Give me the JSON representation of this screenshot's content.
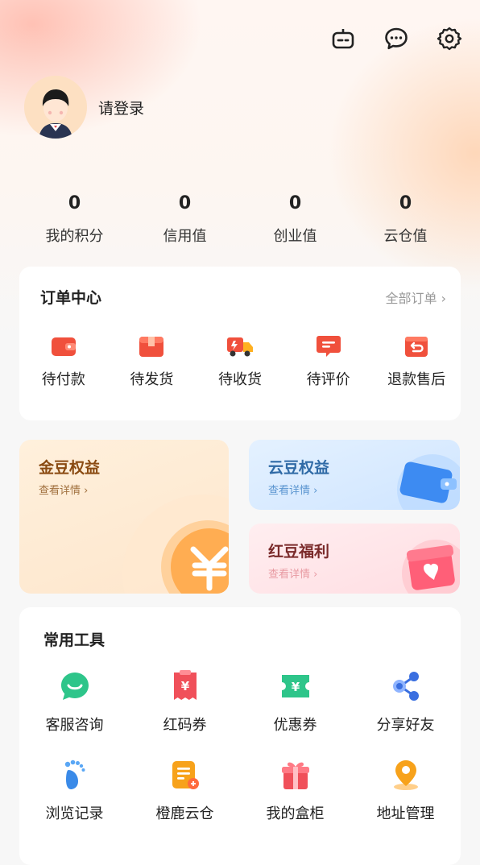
{
  "header": {
    "icons": [
      "robot-icon",
      "message-icon",
      "settings-icon"
    ]
  },
  "profile": {
    "login_text": "请登录"
  },
  "stats": [
    {
      "value": "0",
      "label": "我的积分"
    },
    {
      "value": "0",
      "label": "信用值"
    },
    {
      "value": "0",
      "label": "创业值"
    },
    {
      "value": "0",
      "label": "云仓值"
    }
  ],
  "orders": {
    "title": "订单中心",
    "all_label": "全部订单",
    "items": [
      {
        "label": "待付款",
        "icon": "wallet-icon"
      },
      {
        "label": "待发货",
        "icon": "box-icon"
      },
      {
        "label": "待收货",
        "icon": "truck-icon"
      },
      {
        "label": "待评价",
        "icon": "comment-icon"
      },
      {
        "label": "退款售后",
        "icon": "refund-icon"
      }
    ]
  },
  "benefits": {
    "gold": {
      "title": "金豆权益",
      "sub": "查看详情"
    },
    "cloud": {
      "title": "云豆权益",
      "sub": "查看详情"
    },
    "red": {
      "title": "红豆福利",
      "sub": "查看详情"
    }
  },
  "tools": {
    "title": "常用工具",
    "items": [
      {
        "label": "客服咨询",
        "icon": "customer-service-icon"
      },
      {
        "label": "红码券",
        "icon": "red-coupon-icon"
      },
      {
        "label": "优惠券",
        "icon": "discount-coupon-icon"
      },
      {
        "label": "分享好友",
        "icon": "share-icon"
      },
      {
        "label": "浏览记录",
        "icon": "footprint-icon"
      },
      {
        "label": "橙鹿云仓",
        "icon": "cloud-warehouse-icon"
      },
      {
        "label": "我的盒柜",
        "icon": "gift-box-icon"
      },
      {
        "label": "地址管理",
        "icon": "location-icon"
      }
    ]
  },
  "colors": {
    "accent_red": "#f0503c",
    "gold_text": "#8a4b12",
    "cloud_text": "#2f6aa6",
    "red_text": "#7a2a2a"
  }
}
